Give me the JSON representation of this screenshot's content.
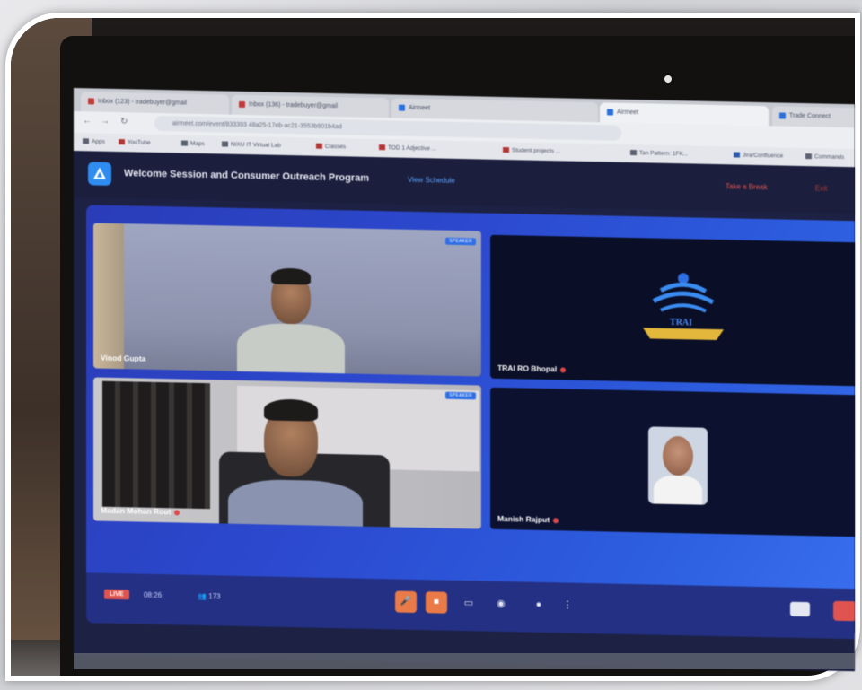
{
  "browser": {
    "tabs": [
      {
        "label": "Inbox (123) - tradebuyer@gmail",
        "icon": "gmail-icon",
        "active": false
      },
      {
        "label": "Inbox (136) - tradebuyer@gmail",
        "icon": "gmail-icon",
        "active": false
      },
      {
        "label": "Airmeet",
        "icon": "airmeet-icon",
        "active": false
      },
      {
        "label": "Airmeet",
        "icon": "airmeet-icon",
        "active": true
      },
      {
        "label": "Trade Connect",
        "icon": "site-icon",
        "active": false
      }
    ],
    "url": "airmeet.com/event/833393 48a25-17eb-ac21-3553b901b4ad",
    "bookmarks": [
      "Apps",
      "YouTube",
      "Maps",
      "NIXU IT Virtual Lab",
      "Classes",
      "TOD 1 Adjective ...",
      "Student projects ...",
      "Tan Pattern: 1FK...",
      "Jira/Confluence",
      "Commands"
    ]
  },
  "app": {
    "title": "Welcome Session and Consumer Outreach Program",
    "view_schedule": "View Schedule",
    "take_break": "Take a Break",
    "exit": "Exit"
  },
  "tiles": [
    {
      "name": "Vinod Gupta",
      "badge": "SPEAKER"
    },
    {
      "name": "TRAI RO Bhopal",
      "logo_text": "TRAI"
    },
    {
      "name": "Madan Mohan Rout",
      "badge": "SPEAKER"
    },
    {
      "name": "Manish Rajput"
    }
  ],
  "controls": {
    "live": "LIVE",
    "timer": "08:26",
    "viewers": "173",
    "more": "⋮"
  },
  "colors": {
    "accent": "#2f6fe6",
    "live": "#e0544f",
    "control_bg": "#233083",
    "header_bg": "#1b1f3d"
  }
}
